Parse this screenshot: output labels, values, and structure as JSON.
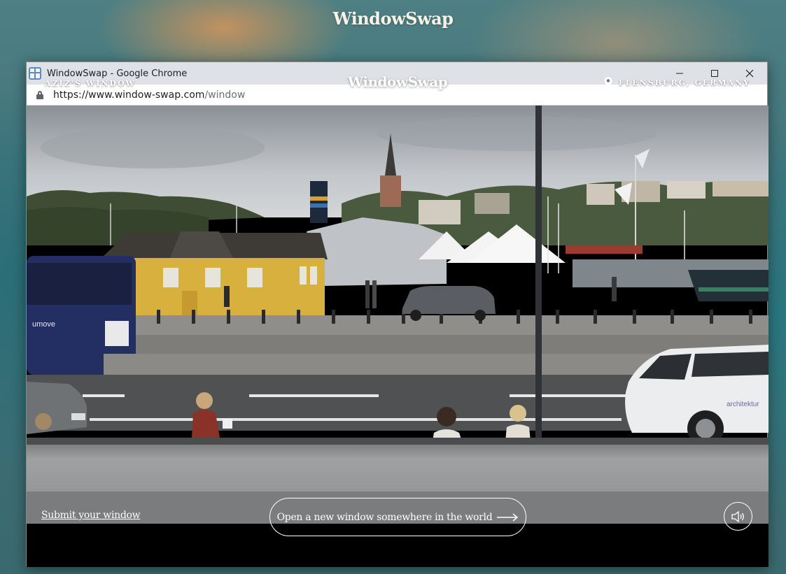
{
  "background": {
    "logo": "WindowSwap"
  },
  "browser": {
    "title": "WindowSwap - Google Chrome",
    "url_host": "https://www.window-swap.com",
    "url_path": "/window",
    "controls": {
      "minimize": "—",
      "maximize": "☐",
      "close": "✕"
    }
  },
  "page": {
    "owner": "AZIZ'S WINDOW",
    "logo": "WindowSwap",
    "location": "FLENSBURG, GERMANY",
    "submit_link": "Submit your window",
    "cta_label": "Open a new window somewhere in the world",
    "icons": {
      "pin": "map-pin-icon",
      "arrow": "arrow-right-icon",
      "sound": "speaker-icon"
    }
  },
  "scene": {
    "bus_text": "umove"
  }
}
